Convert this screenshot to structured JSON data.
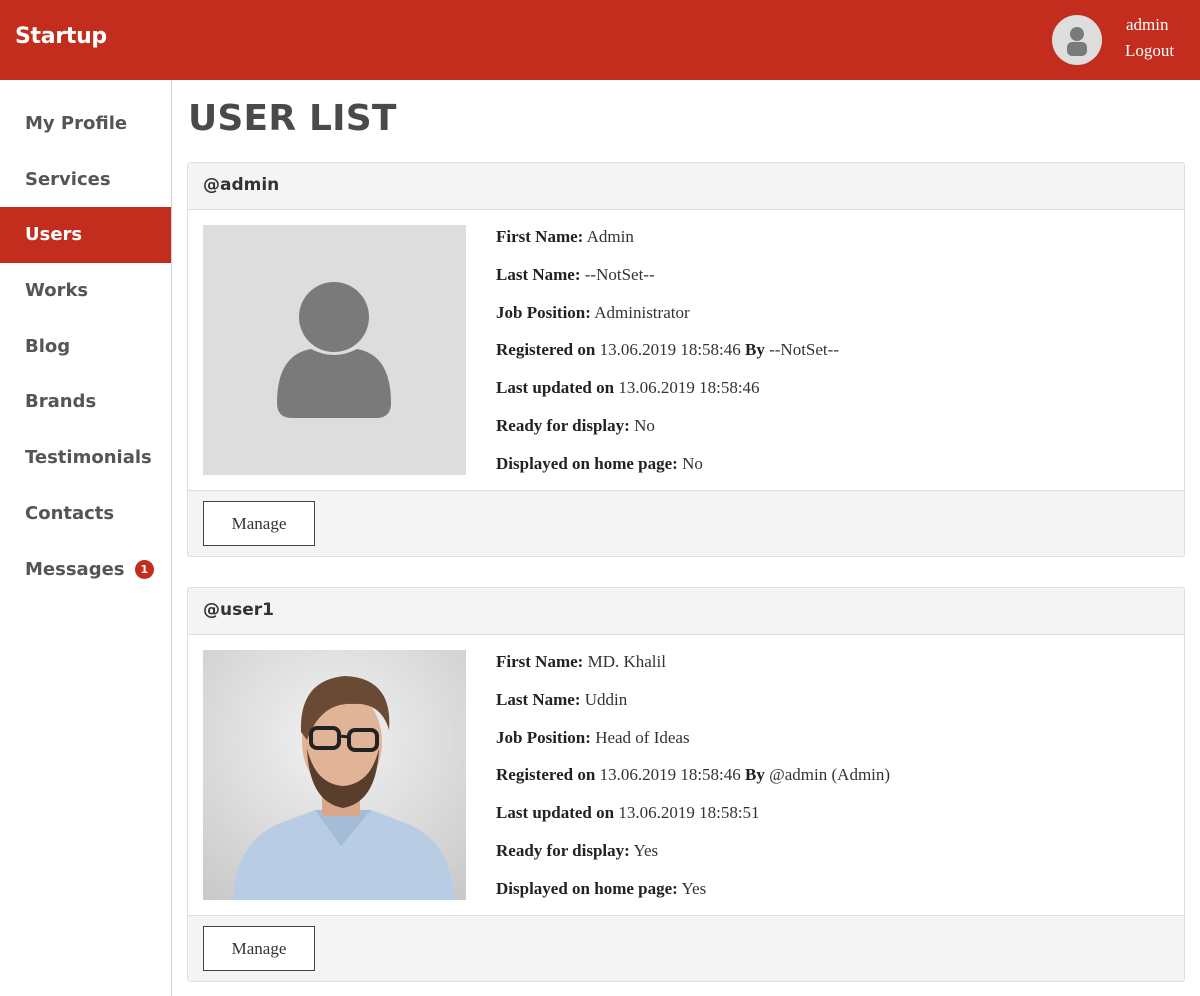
{
  "header": {
    "brand": "Startup",
    "user_name": "admin",
    "logout_label": "Logout",
    "brand_color": "#c22d1e"
  },
  "sidebar": {
    "items": [
      {
        "label": "My Profile"
      },
      {
        "label": "Services"
      },
      {
        "label": "Users",
        "active": true
      },
      {
        "label": "Works"
      },
      {
        "label": "Blog"
      },
      {
        "label": "Brands"
      },
      {
        "label": "Testimonials"
      },
      {
        "label": "Contacts"
      },
      {
        "label": "Messages",
        "badge": "1"
      }
    ]
  },
  "main": {
    "title": "USER LIST",
    "users": [
      {
        "username": "@admin",
        "photo": "placeholder-avatar",
        "first_name_label": "First Name:",
        "first_name": "Admin",
        "last_name_label": "Last Name:",
        "last_name": "--NotSet--",
        "job_label": "Job Position:",
        "job": "Administrator",
        "registered_label": "Registered on",
        "registered": "13.06.2019 18:58:46",
        "by_label": "By",
        "registered_by": "--NotSet--",
        "updated_label": "Last updated on",
        "updated": "13.06.2019 18:58:46",
        "ready_label": "Ready for display:",
        "ready": "No",
        "home_label": "Displayed on home page:",
        "home": "No",
        "manage_label": "Manage"
      },
      {
        "username": "@user1",
        "photo": "portrait-photo",
        "first_name_label": "First Name:",
        "first_name": "MD. Khalil",
        "last_name_label": "Last Name:",
        "last_name": "Uddin",
        "job_label": "Job Position:",
        "job": "Head of Ideas",
        "registered_label": "Registered on",
        "registered": "13.06.2019 18:58:46",
        "by_label": "By",
        "registered_by": "@admin (Admin)",
        "updated_label": "Last updated on",
        "updated": "13.06.2019 18:58:51",
        "ready_label": "Ready for display:",
        "ready": "Yes",
        "home_label": "Displayed on home page:",
        "home": "Yes",
        "manage_label": "Manage"
      }
    ]
  }
}
